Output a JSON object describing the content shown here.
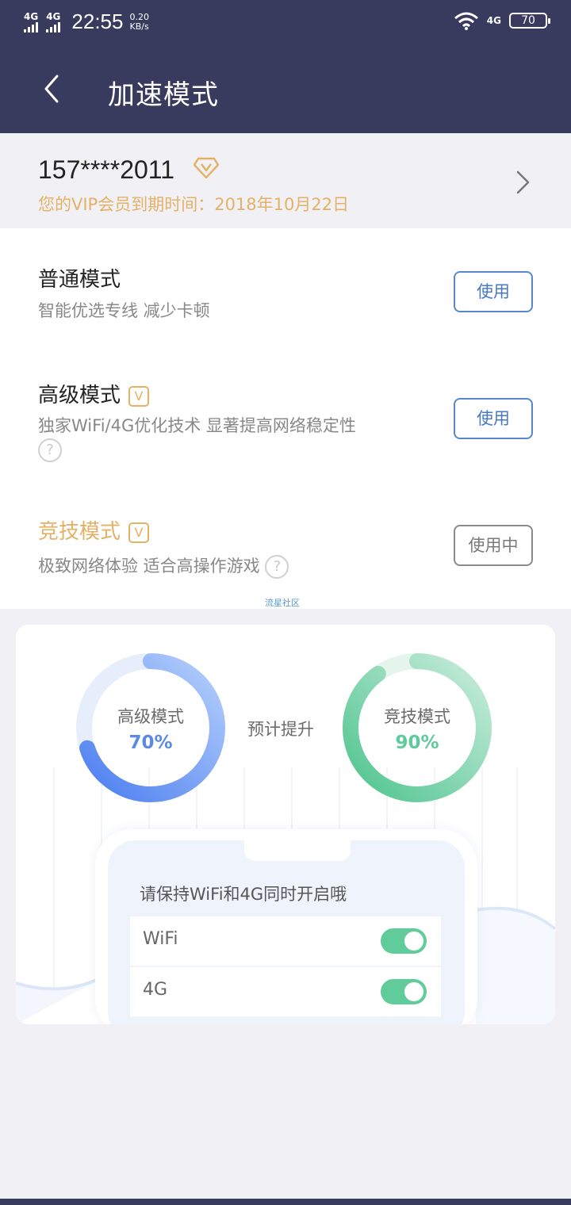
{
  "status_bar": {
    "sim1": "4G",
    "sim2": "4G",
    "time": "22:55",
    "speed_value": "0.20",
    "speed_unit": "KB/s",
    "network_right": "4G",
    "battery": "70"
  },
  "header": {
    "title": "加速模式"
  },
  "account": {
    "phone": "157****2011",
    "vip_expire": "您的VIP会员到期时间：2018年10月22日"
  },
  "modes": [
    {
      "title": "普通模式",
      "desc": "智能优选专线 减少卡顿",
      "button": "使用"
    },
    {
      "title": "高级模式",
      "vip": "V",
      "desc": "独家WiFi/4G优化技术 显著提高网络稳定性",
      "help": "?",
      "button": "使用"
    },
    {
      "title": "竞技模式",
      "vip": "V",
      "desc": "极致网络体验 适合高操作游戏",
      "help": "?",
      "button": "使用中"
    }
  ],
  "watermark": "流星社区",
  "boost": {
    "predict_label": "预计提升",
    "advanced": {
      "name": "高级模式",
      "value": "70%",
      "fraction": 0.7,
      "color": "#5b8ae6"
    },
    "competitive": {
      "name": "竞技模式",
      "value": "90%",
      "fraction": 0.9,
      "color": "#5dcb9a"
    }
  },
  "phone_card": {
    "tip": "请保持WiFi和4G同时开启哦",
    "toggles": [
      {
        "label": "WiFi",
        "on": true
      },
      {
        "label": "4G",
        "on": true
      }
    ]
  }
}
